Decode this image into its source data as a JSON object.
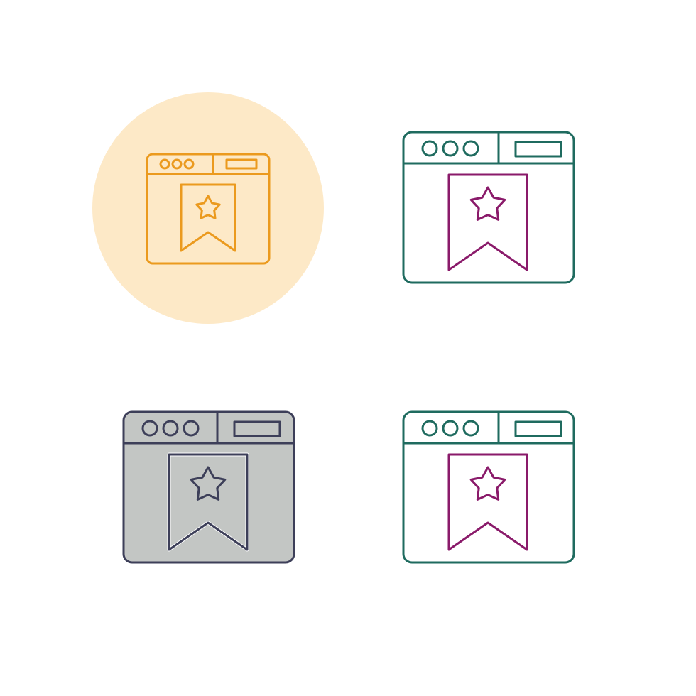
{
  "icon_set": {
    "subject": "browser-window-bookmark-star",
    "variants": [
      {
        "style": "line-on-circle",
        "icon": "web-bookmark-icon",
        "line_color": "#eb9a1e",
        "circle_color": "#fde9c7"
      },
      {
        "style": "two-tone-line",
        "icon": "web-bookmark-icon",
        "frame_color": "#1f6b5f",
        "bookmark_color": "#8a1a6a"
      },
      {
        "style": "filled",
        "icon": "web-bookmark-icon",
        "fill_color": "#c3c6c4",
        "line_color": "#3d3f59",
        "inner_line_color": "#ffffff"
      },
      {
        "style": "two-tone-line",
        "icon": "web-bookmark-icon",
        "frame_color": "#1f6b5f",
        "bookmark_color": "#8a1a6a"
      }
    ]
  }
}
